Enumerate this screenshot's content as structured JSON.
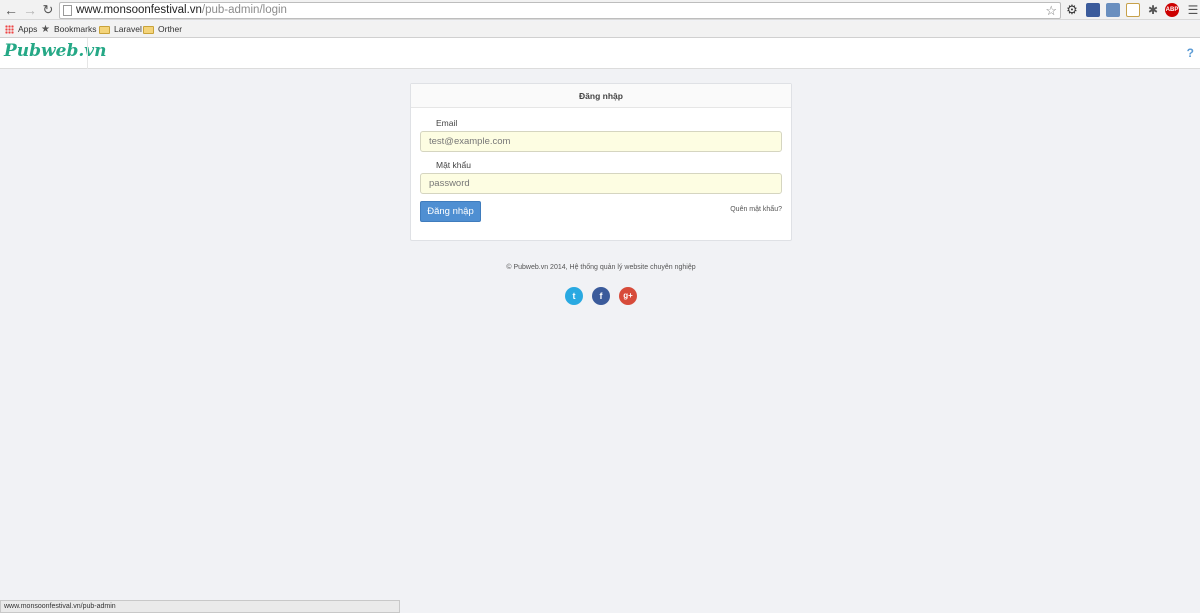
{
  "browser": {
    "url_host": "www.monsoonfestival.vn",
    "url_path": "/pub-admin/login",
    "bookmarks": [
      {
        "label": "Apps"
      },
      {
        "label": "Bookmarks"
      },
      {
        "label": "Laravel"
      },
      {
        "label": "Orther"
      }
    ],
    "abp_label": "ABP",
    "status_url": "www.monsoonfestival.vn/pub-admin"
  },
  "header": {
    "brand": "Pubweb.vn",
    "help_label": "?"
  },
  "login": {
    "title": "Đăng nhập",
    "email_label": "Email",
    "email_placeholder": "test@example.com",
    "password_label": "Mật khẩu",
    "password_placeholder": "password",
    "submit_label": "Đăng nhập",
    "forgot_label": "Quên mật khẩu?"
  },
  "footer": {
    "copyright": "© Pubweb.vn 2014, Hệ thống quản lý website chuyên nghiệp",
    "social": [
      {
        "name": "twitter-icon",
        "glyph": "t",
        "color": "#29a9e1"
      },
      {
        "name": "facebook-icon",
        "glyph": "f",
        "color": "#3b5b9b"
      },
      {
        "name": "google-plus-icon",
        "glyph": "g+",
        "color": "#d74b3a"
      }
    ]
  },
  "colors": {
    "brand": "#25a886",
    "primary_button": "#4f8fd2",
    "page_background": "#f1f2f5",
    "input_autofill": "#fdfde2"
  }
}
